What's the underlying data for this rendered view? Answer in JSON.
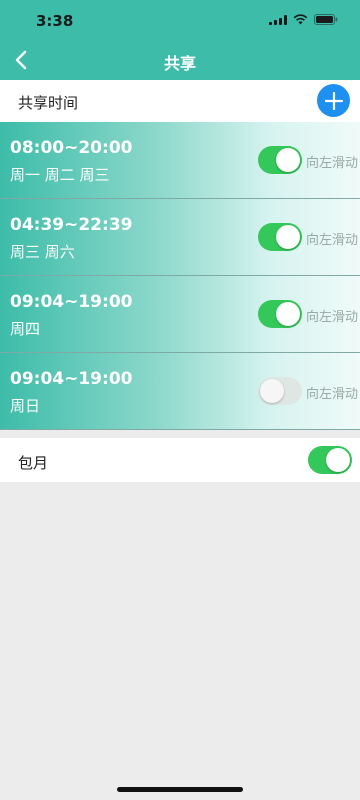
{
  "status": {
    "time": "3:38"
  },
  "nav": {
    "title": "共享"
  },
  "section": {
    "title": "共享时间"
  },
  "rows": [
    {
      "time": "08:00~20:00",
      "days": "周一 周二 周三",
      "enabled": true,
      "hint": "向左滑动"
    },
    {
      "time": "04:39~22:39",
      "days": "周三 周六",
      "enabled": true,
      "hint": "向左滑动"
    },
    {
      "time": "09:04~19:00",
      "days": "周四",
      "enabled": true,
      "hint": "向左滑动"
    },
    {
      "time": "09:04~19:00",
      "days": "周日",
      "enabled": false,
      "hint": "向左滑动"
    }
  ],
  "monthly": {
    "label": "包月",
    "enabled": true
  },
  "colors": {
    "accent": "#3dbca9",
    "toggle_on": "#34c759",
    "add_button": "#1e90f0"
  }
}
